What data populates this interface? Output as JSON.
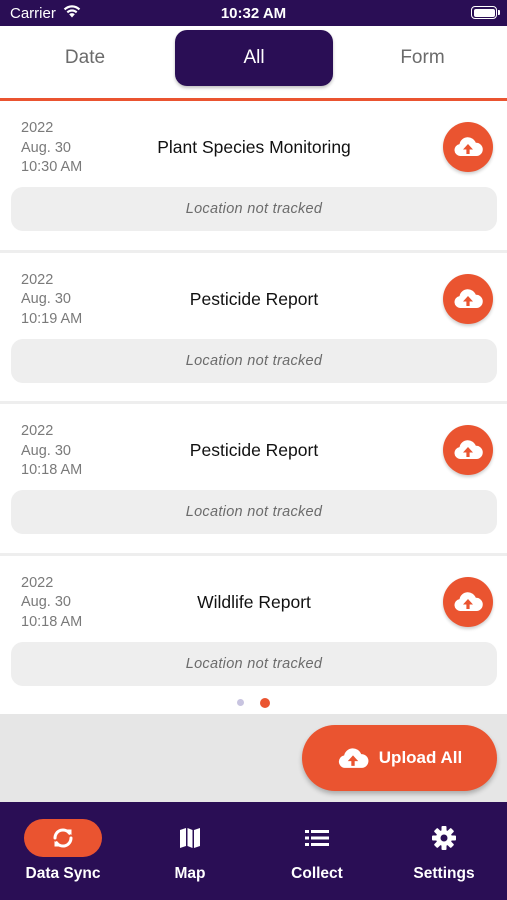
{
  "status_bar": {
    "carrier": "Carrier",
    "time": "10:32 AM"
  },
  "tabs": [
    {
      "label": "Date",
      "selected": false
    },
    {
      "label": "All",
      "selected": true
    },
    {
      "label": "Form",
      "selected": false
    }
  ],
  "records": [
    {
      "year": "2022",
      "date": "Aug. 30",
      "time": "10:30 AM",
      "title": "Plant Species Monitoring",
      "location": "Location not tracked",
      "icon": "cloud-upload-icon"
    },
    {
      "year": "2022",
      "date": "Aug. 30",
      "time": "10:19 AM",
      "title": "Pesticide Report",
      "location": "Location not tracked",
      "icon": "cloud-upload-icon"
    },
    {
      "year": "2022",
      "date": "Aug. 30",
      "time": "10:18 AM",
      "title": "Pesticide Report",
      "location": "Location not tracked",
      "icon": "cloud-upload-icon"
    },
    {
      "year": "2022",
      "date": "Aug. 30",
      "time": "10:18 AM",
      "title": "Wildlife Report",
      "location": "Location not tracked",
      "icon": "cloud-upload-icon"
    }
  ],
  "pagination": {
    "total": 2,
    "current": 2
  },
  "upload_all": {
    "label": "Upload All",
    "icon": "cloud-upload-icon"
  },
  "nav": [
    {
      "label": "Data Sync",
      "icon": "sync-icon",
      "active": true
    },
    {
      "label": "Map",
      "icon": "map-icon",
      "active": false
    },
    {
      "label": "Collect",
      "icon": "list-icon",
      "active": false
    },
    {
      "label": "Settings",
      "icon": "gear-icon",
      "active": false
    }
  ],
  "colors": {
    "primary": "#2a0e55",
    "accent": "#ea5430",
    "location_bg": "#eeeeee"
  }
}
